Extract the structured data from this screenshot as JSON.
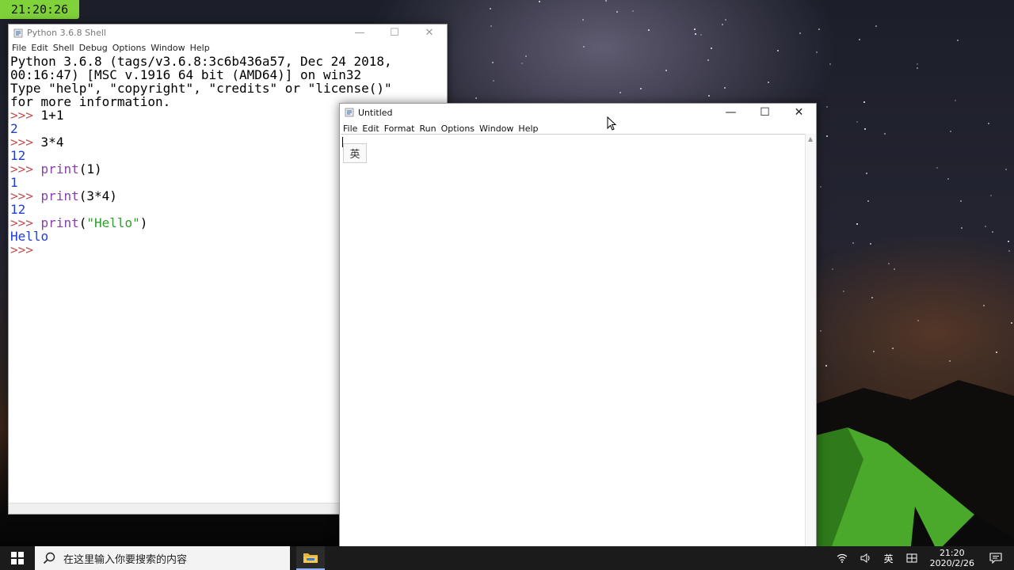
{
  "clock": {
    "time": "21:20:26"
  },
  "shell": {
    "title": "Python 3.6.8 Shell",
    "menu": [
      "File",
      "Edit",
      "Shell",
      "Debug",
      "Options",
      "Window",
      "Help"
    ],
    "banner": [
      "Python 3.6.8 (tags/v3.6.8:3c6b436a57, Dec 24 2018,",
      "00:16:47) [MSC v.1916 64 bit (AMD64)] on win32",
      "Type \"help\", \"copyright\", \"credits\" or \"license()\"",
      "for more information."
    ],
    "prompt": ">>>",
    "session": [
      {
        "input": "1+1",
        "output": "2"
      },
      {
        "input": "3*4",
        "output": "12"
      },
      {
        "input_fn": "print",
        "input_arg": "(1)",
        "output": "1"
      },
      {
        "input_fn": "print",
        "input_arg": "(3*4)",
        "output": "12"
      },
      {
        "input_fn": "print",
        "input_open": "(",
        "input_str": "\"Hello\"",
        "input_close": ")",
        "output": "Hello"
      }
    ]
  },
  "editor": {
    "title": "Untitled",
    "menu": [
      "File",
      "Edit",
      "Format",
      "Run",
      "Options",
      "Window",
      "Help"
    ],
    "ime_indicator": "英"
  },
  "taskbar": {
    "search_placeholder": "在这里输入你要搜索的内容",
    "tray": {
      "ime": "英",
      "time": "21:20",
      "date": "2020/2/26"
    }
  },
  "icons": {
    "start": "windows-logo-icon",
    "search": "search-icon",
    "file_explorer": "folder-icon",
    "network": "wifi-icon",
    "volume": "speaker-icon",
    "ime_mode": "ime-grid-icon",
    "notifications": "notification-icon"
  }
}
